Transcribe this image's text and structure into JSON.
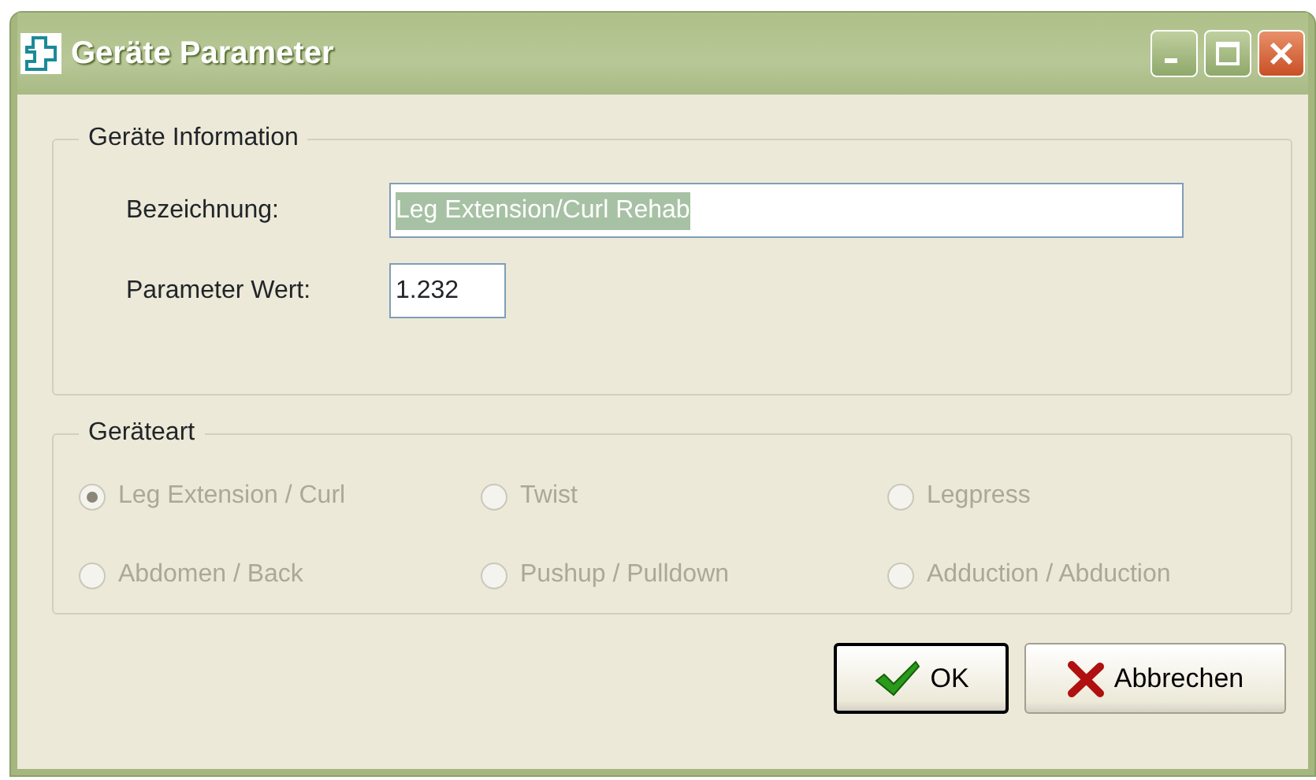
{
  "window": {
    "title": "Geräte Parameter"
  },
  "info_group": {
    "legend": "Geräte Information",
    "fields": [
      {
        "label": "Bezeichnung:",
        "value": "Leg Extension/Curl Rehab",
        "text_selected": true,
        "kind": "text"
      },
      {
        "label": "Parameter Wert:",
        "value": "1.232",
        "text_selected": false,
        "kind": "number"
      }
    ]
  },
  "type_group": {
    "legend": "Geräteart",
    "options": [
      {
        "label": "Leg Extension / Curl",
        "selected": true,
        "disabled": true
      },
      {
        "label": "Twist",
        "selected": false,
        "disabled": true
      },
      {
        "label": "Legpress",
        "selected": false,
        "disabled": true
      },
      {
        "label": "Abdomen / Back",
        "selected": false,
        "disabled": true
      },
      {
        "label": "Pushup / Pulldown",
        "selected": false,
        "disabled": true
      },
      {
        "label": "Adduction / Abduction",
        "selected": false,
        "disabled": true
      }
    ]
  },
  "buttons": [
    {
      "label": "OK",
      "kind": "ok"
    },
    {
      "label": "Abbrechen",
      "kind": "cancel"
    }
  ]
}
